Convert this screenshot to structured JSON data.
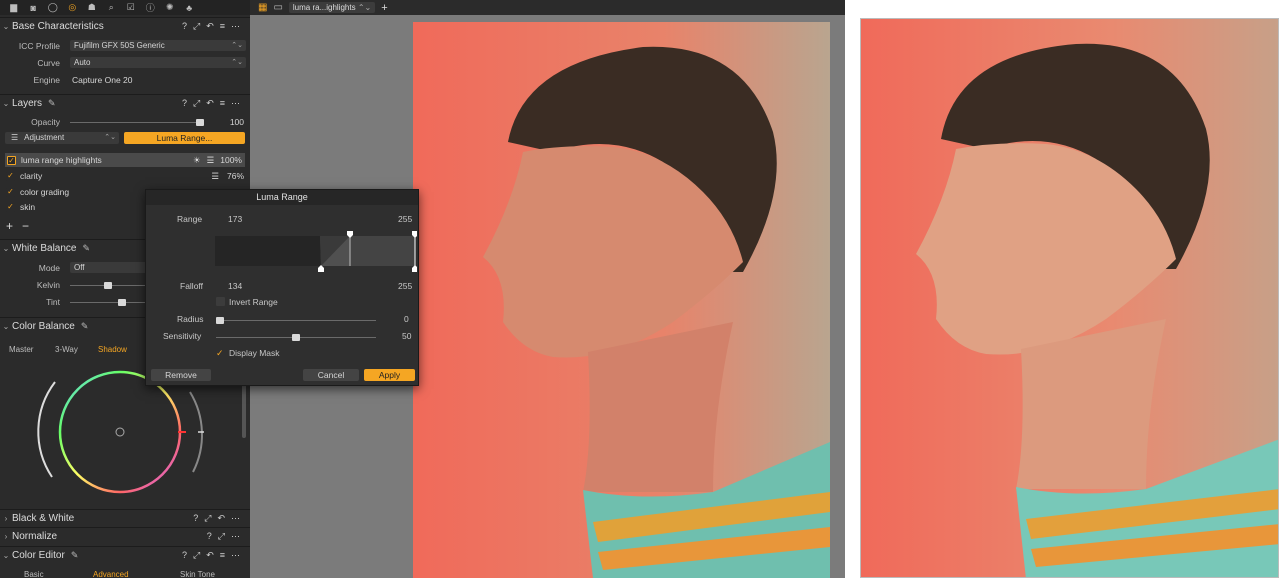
{
  "toolbar": {
    "icons": [
      "folder-icon",
      "camera-icon",
      "circle-icon",
      "layers-icon",
      "color-icon",
      "search-icon",
      "check-icon",
      "info-icon",
      "gear-icon",
      "sliders-icon"
    ]
  },
  "base": {
    "title": "Base Characteristics",
    "rows": [
      {
        "label": "ICC Profile",
        "value": "Fujifilm GFX 50S Generic"
      },
      {
        "label": "Curve",
        "value": "Auto"
      },
      {
        "label": "Engine",
        "value": "Capture One 20"
      }
    ]
  },
  "layers": {
    "title": "Layers",
    "opacity_label": "Opacity",
    "opacity_value": "100",
    "opacity_level": 1.0,
    "adjustment_label": "Adjustment",
    "luma_button": "Luma Range...",
    "items": [
      {
        "name": "luma range highlights",
        "value": "100%",
        "checked": true
      },
      {
        "name": "clarity",
        "value": "76%",
        "checked": true
      },
      {
        "name": "color grading",
        "value": "",
        "checked": true
      },
      {
        "name": "skin",
        "value": "",
        "checked": true
      }
    ]
  },
  "wb": {
    "title": "White Balance",
    "mode_label": "Mode",
    "mode_value": "Off",
    "kelvin_label": "Kelvin",
    "tint_label": "Tint"
  },
  "cb": {
    "title": "Color Balance",
    "tabs": [
      "Master",
      "3-Way",
      "Shadow"
    ]
  },
  "bw": {
    "title": "Black & White"
  },
  "normalize": {
    "title": "Normalize"
  },
  "ce": {
    "title": "Color Editor",
    "tabs": [
      "Basic",
      "Advanced",
      "Skin Tone"
    ]
  },
  "viewer": {
    "variant": "luma ra...ighlights"
  },
  "dialog": {
    "title": "Luma Range",
    "range_label": "Range",
    "range_low": "173",
    "range_high": "255",
    "falloff_label": "Falloff",
    "falloff_low": "134",
    "falloff_high": "255",
    "invert_label": "Invert Range",
    "radius_label": "Radius",
    "radius_value": "0",
    "sensitivity_label": "Sensitivity",
    "sensitivity_value": "50",
    "mask_label": "Display Mask",
    "remove": "Remove",
    "cancel": "Cancel",
    "apply": "Apply"
  },
  "colors": {
    "accent": "#f5a623",
    "panel": "#2b2b2b",
    "coral": "#f06a5a"
  }
}
